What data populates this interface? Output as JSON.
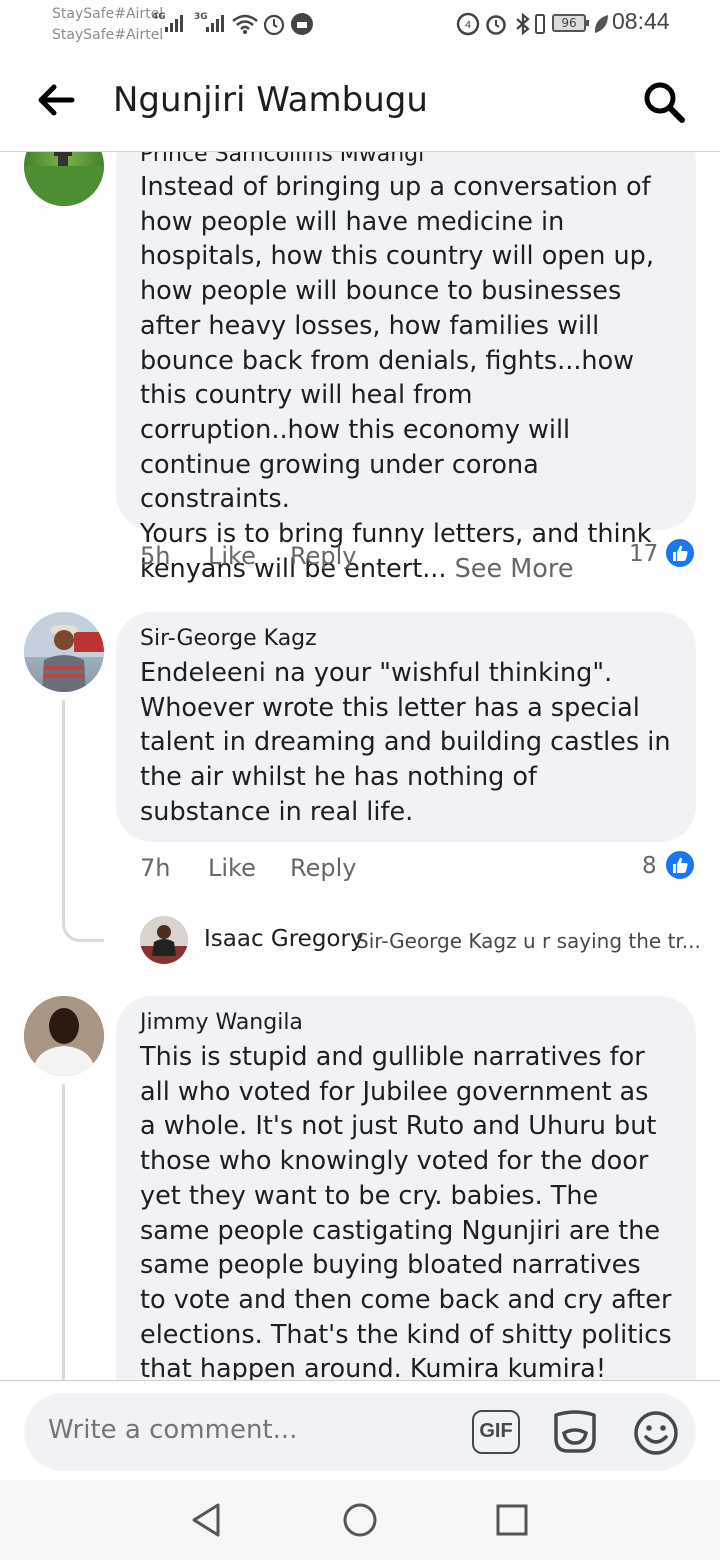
{
  "status_bar": {
    "carrier_1": "StaySafe#Airtel",
    "carrier_2": "StaySafe#Airtel",
    "signal_1": "4G",
    "signal_2": "3G",
    "battery": "96",
    "time": "08:44"
  },
  "header": {
    "title": "Ngunjiri Wambugu",
    "back_icon": "arrow-left-icon",
    "search_icon": "search-icon"
  },
  "comments": [
    {
      "author": "Prince Samcollins Mwangi",
      "text": "Instead of bringing up a conversation of how people will have medicine in hospitals, how this country will open up, how people will bounce to businesses after heavy losses, how families will bounce back from denials, fights...how this country will heal from corruption..how this economy will continue growing under corona constraints.",
      "text_2": "Yours is to bring funny letters, and think kenyans will be entert...",
      "see_more": "See More",
      "time": "5h",
      "like_label": "Like",
      "reply_label": "Reply",
      "reactions": "17"
    },
    {
      "author": "Sir-George Kagz",
      "text": "Endeleeni na your \"wishful thinking\". Whoever wrote this letter has a special talent in dreaming and building castles in the air whilst he has nothing of substance in real life.",
      "time": "7h",
      "like_label": "Like",
      "reply_label": "Reply",
      "reactions": "8",
      "reply": {
        "author": "Isaac Gregory",
        "preview": "Sir-George Kagz u r saying the tr..."
      }
    },
    {
      "author": "Jimmy Wangila",
      "text": "This is stupid and gullible narratives for all who voted for Jubilee government as a whole. It's not just Ruto and Uhuru but those who knowingly voted for the door yet they want to be cry.   babies. The same people castigating Ngunjiri are the same people buying bloated narratives to vote and then come back and cry after elections. That's the kind of shitty politics that happen around. Kumira kumira!"
    }
  ],
  "composer": {
    "placeholder": "Write a comment...",
    "gif_label": "GIF",
    "sticker_icon": "sticker-icon",
    "emoji_icon": "emoji-icon"
  },
  "nav": {
    "back_icon": "nav-back-icon",
    "home_icon": "nav-home-icon",
    "recents_icon": "nav-recents-icon"
  },
  "colors": {
    "like_blue": "#1877f2",
    "bubble_bg": "#f0f2f5",
    "meta_gray": "#65676b"
  }
}
